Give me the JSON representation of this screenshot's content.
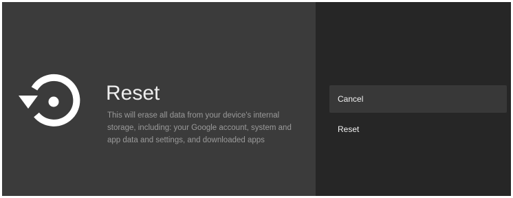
{
  "panel": {
    "icon": "reset-icon",
    "title": "Reset",
    "description": "This will erase all data from your device's internal storage, including: your Google account, system and app data and settings, and downloaded apps"
  },
  "options": [
    {
      "label": "Cancel",
      "focused": true
    },
    {
      "label": "Reset",
      "focused": false
    }
  ],
  "colors": {
    "left_panel_bg": "#3b3b3b",
    "right_panel_bg": "#262626",
    "focused_option_bg": "#383838",
    "title_text": "#eeeeee",
    "description_text": "#9a9a9a"
  }
}
